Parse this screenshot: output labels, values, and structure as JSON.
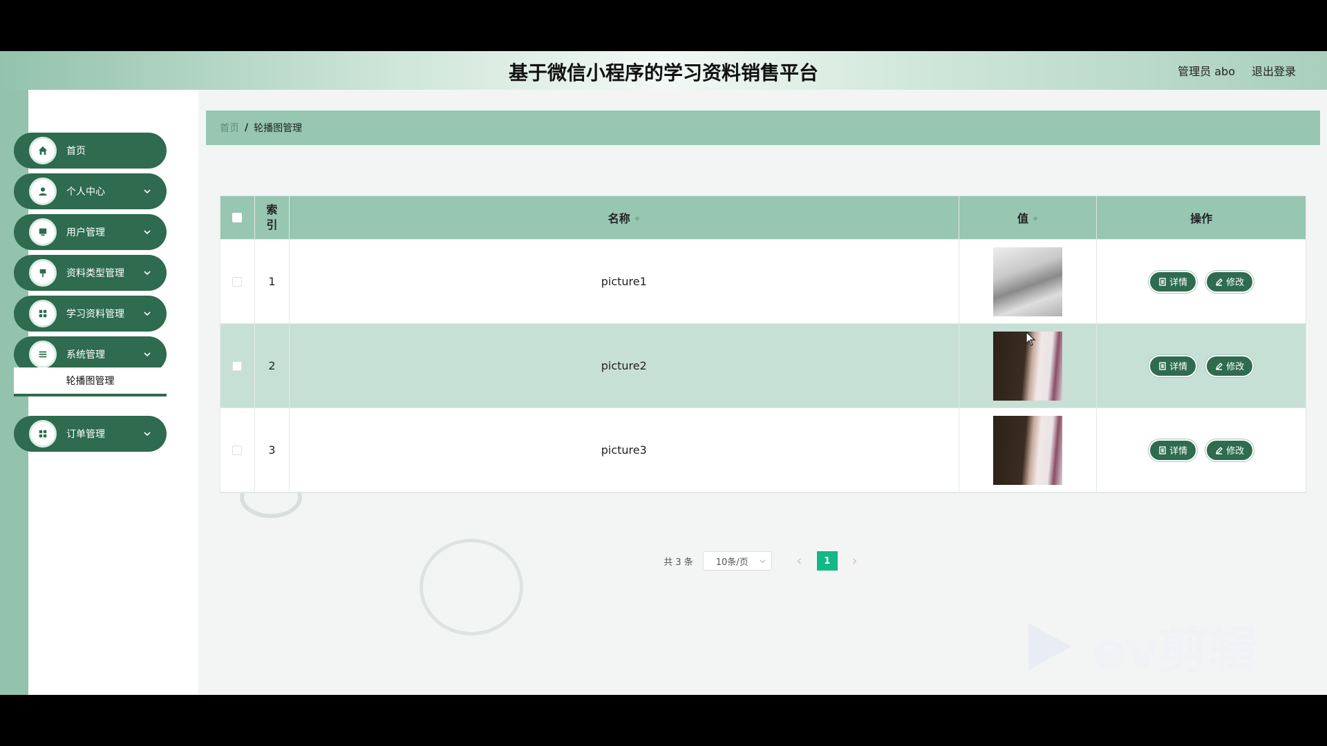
{
  "header": {
    "title": "基于微信小程序的学习资料销售平台",
    "user": "管理员 abo",
    "logout": "退出登录"
  },
  "sidebar": {
    "items": [
      {
        "label": "首页",
        "icon": "home-icon"
      },
      {
        "label": "个人中心",
        "icon": "user-icon"
      },
      {
        "label": "用户管理",
        "icon": "monitor-icon"
      },
      {
        "label": "资料类型管理",
        "icon": "pin-icon"
      },
      {
        "label": "学习资料管理",
        "icon": "grid-icon"
      },
      {
        "label": "系统管理",
        "icon": "list-icon"
      },
      {
        "label": "订单管理",
        "icon": "grid-icon"
      }
    ],
    "submenu_active": "轮播图管理"
  },
  "breadcrumb": {
    "home": "首页",
    "separator": "/",
    "current": "轮播图管理"
  },
  "table": {
    "headers": {
      "index": "索引",
      "name": "名称",
      "value": "值",
      "ops": "操作"
    },
    "rows": [
      {
        "index": "1",
        "name": "picture1"
      },
      {
        "index": "2",
        "name": "picture2"
      },
      {
        "index": "3",
        "name": "picture3"
      }
    ],
    "detail_label": "详情",
    "edit_label": "修改"
  },
  "pagination": {
    "total": "共 3 条",
    "page_size": "10条/页",
    "current_page": "1"
  },
  "watermark": "ev剪辑",
  "colors": {
    "primary": "#2e6b4f",
    "header_row": "#97c6b1",
    "alt_row": "#c7e0d6",
    "active_page": "#12b886"
  }
}
